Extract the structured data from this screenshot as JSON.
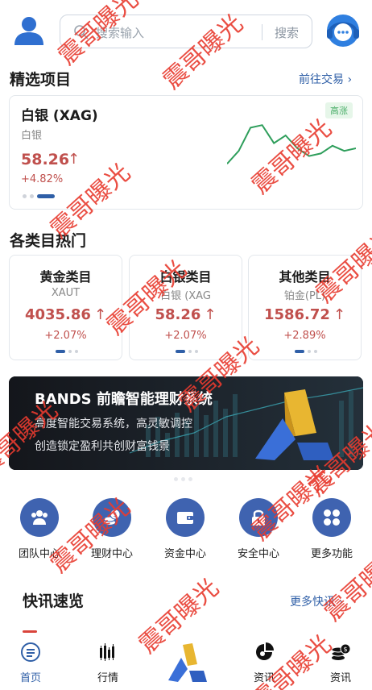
{
  "header": {
    "search_placeholder": "搜索输入",
    "search_button": "搜索"
  },
  "featured": {
    "title": "精选项目",
    "link": "前往交易 ›",
    "item": {
      "name": "白银 (XAG)",
      "sub": "白银",
      "price": "58.26",
      "arrow": "↑",
      "change": "+4.82%",
      "badge": "高涨",
      "sparkline_trend": [
        0.2,
        0.45,
        0.9,
        0.95,
        0.6,
        0.75,
        0.5,
        0.35,
        0.4,
        0.55,
        0.45,
        0.5
      ]
    }
  },
  "categories": {
    "title": "各类目热门",
    "items": [
      {
        "title": "黄金类目",
        "sub": "XAUT",
        "price": "4035.86",
        "arrow": "↑",
        "change": "+2.07%"
      },
      {
        "title": "白银类目",
        "sub": "白银 (XAG",
        "price": "58.26",
        "arrow": "↑",
        "change": "+2.07%"
      },
      {
        "title": "其他类目",
        "sub": "铂金(PL)",
        "price": "1586.72",
        "arrow": "↑",
        "change": "+2.89%"
      }
    ]
  },
  "banner": {
    "title": "BANDS 前瞻智能理财系统",
    "line1": "高度智能交易系统，高灵敏调控",
    "line2": "创造锁定盈利共创财富钱景"
  },
  "quick_menu": [
    {
      "label": "团队中心",
      "icon": "team-icon"
    },
    {
      "label": "理财中心",
      "icon": "coins-icon"
    },
    {
      "label": "资金中心",
      "icon": "wallet-icon"
    },
    {
      "label": "安全中心",
      "icon": "lock-icon"
    },
    {
      "label": "更多功能",
      "icon": "grid-icon"
    }
  ],
  "news": {
    "title": "快讯速览",
    "link": "更多快讯 ›"
  },
  "bottom_nav": [
    {
      "label": "首页",
      "icon": "home-icon",
      "active": true
    },
    {
      "label": "行情",
      "icon": "candlestick-icon",
      "active": false
    },
    {
      "label": "资讯",
      "icon": "pie-chart-icon",
      "active": false
    },
    {
      "label": "资讯",
      "icon": "coin-stack-icon",
      "active": false
    }
  ],
  "watermark": "震哥曝光",
  "colors": {
    "brand_blue": "#2f5fa7",
    "price_red": "#c0504d",
    "sparkline_green": "#2e9e5b",
    "watermark_red": "#e83b2f"
  }
}
